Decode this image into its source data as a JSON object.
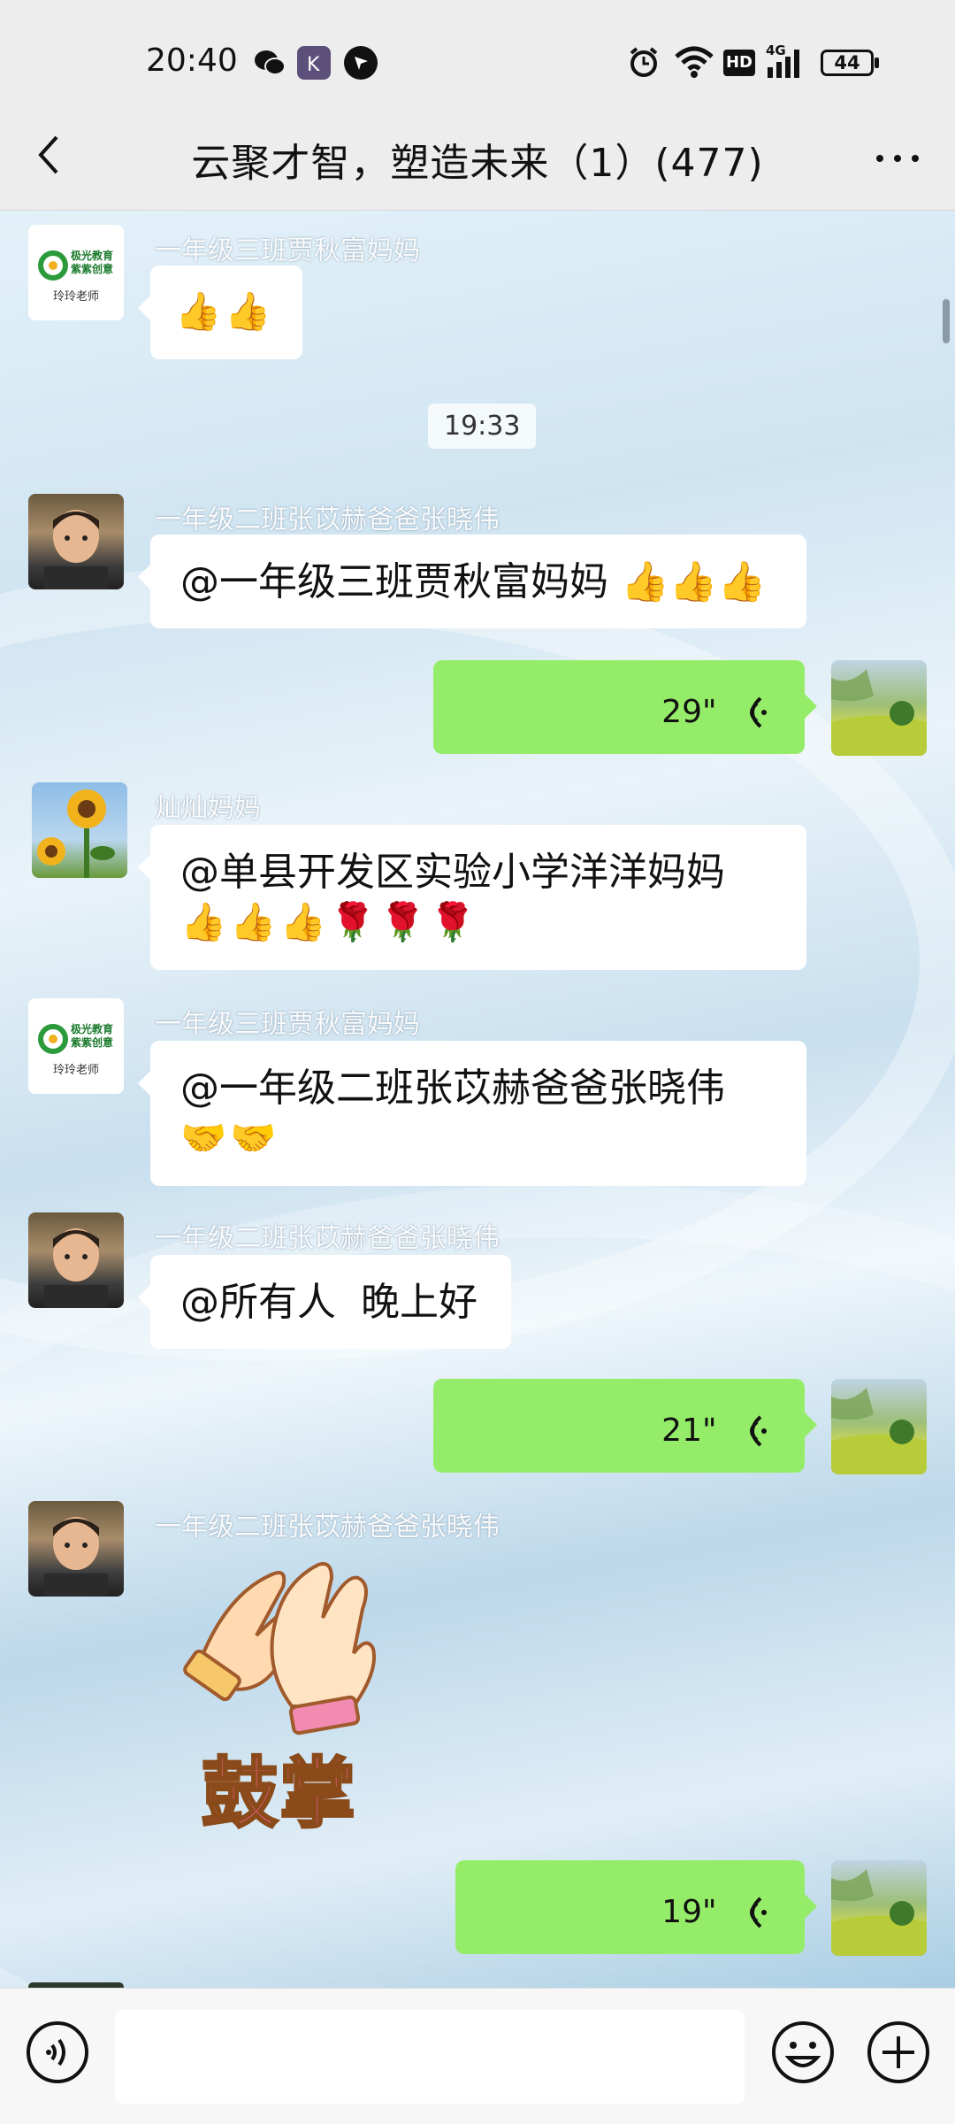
{
  "status_bar": {
    "time": "20:40",
    "network": "4G",
    "hd": "HD",
    "battery": "44"
  },
  "nav": {
    "title": "云聚才智，塑造未来（1）(477)"
  },
  "chat": {
    "time_divider": "19:33",
    "messages": [
      {
        "sender": "一年级三班贾秋富妈妈",
        "avatar_caption": "玲玲老师",
        "avatar_logo": "极光教育\n紫紫创意",
        "text": "👍👍"
      },
      {
        "sender": "一年级二班张苡赫爸爸张晓伟",
        "text": "@一年级三班贾秋富妈妈 👍👍👍"
      },
      {
        "self": true,
        "voice_duration": "29\""
      },
      {
        "sender": "灿灿妈妈",
        "text_line1": "@单县开发区实验小学洋洋妈妈",
        "text_line2": "👍👍👍🌹🌹🌹"
      },
      {
        "sender": "一年级三班贾秋富妈妈",
        "avatar_caption": "玲玲老师",
        "text_line1": "@一年级二班张苡赫爸爸张晓伟",
        "text_line2": "🤝🤝"
      },
      {
        "sender": "一年级二班张苡赫爸爸张晓伟",
        "text": "@所有人  晚上好"
      },
      {
        "self": true,
        "voice_duration": "21\""
      },
      {
        "sender": "一年级二班张苡赫爸爸张晓伟",
        "sticker_text": "鼓掌"
      },
      {
        "self": true,
        "voice_duration": "19\""
      }
    ]
  },
  "colors": {
    "voice_bubble": "#95ec69",
    "background": "#ededed"
  },
  "icons": {
    "back": "chevron-left-icon",
    "more": "more-icon",
    "voice_input": "voice-input-icon",
    "emoji": "emoji-icon",
    "add": "plus-icon"
  }
}
